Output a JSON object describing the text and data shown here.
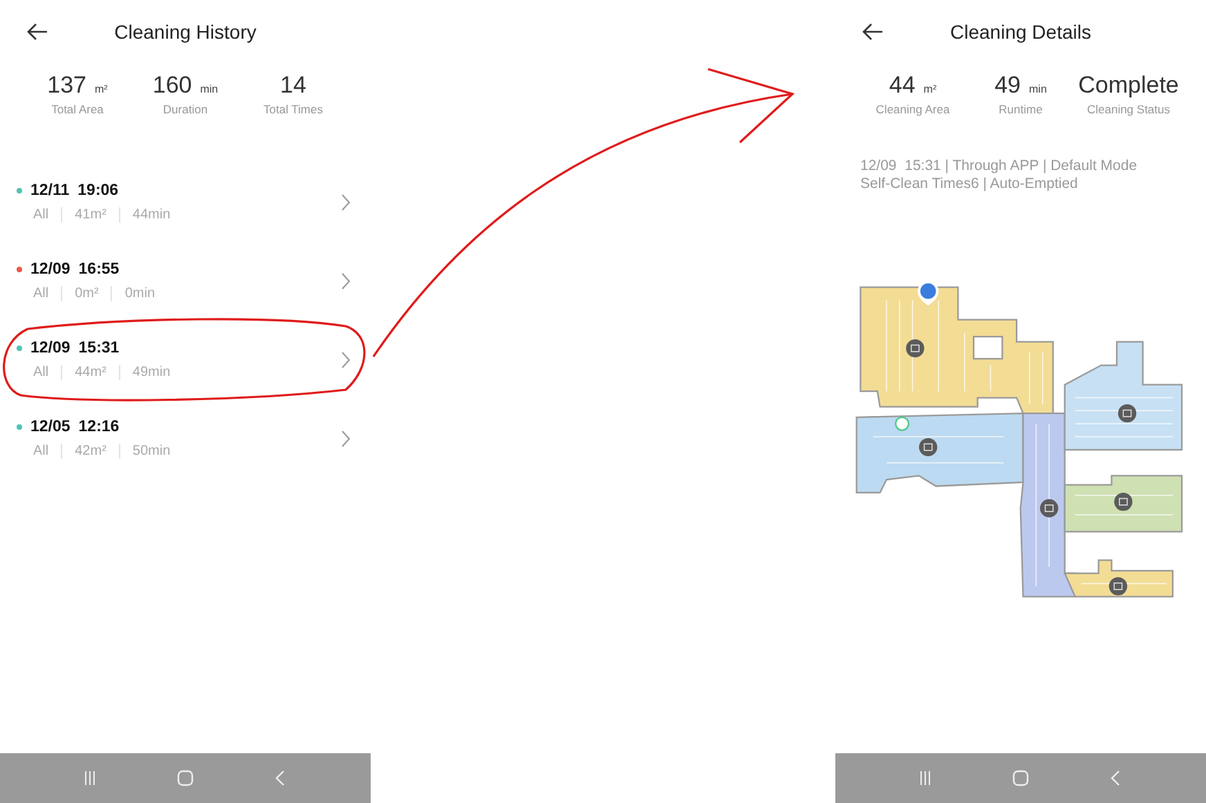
{
  "history_screen": {
    "title": "Cleaning History",
    "stats": [
      {
        "value": "137",
        "unit": "m²",
        "label": "Total Area"
      },
      {
        "value": "160",
        "unit": "min",
        "label": "Duration"
      },
      {
        "value": "14",
        "label": "Total Times"
      }
    ],
    "records": [
      {
        "date": "12/11",
        "time": "19:06",
        "mode": "All",
        "area": "41m²",
        "duration": "44min",
        "color": "#4fc3b4",
        "circled": false
      },
      {
        "date": "12/09",
        "time": "16:55",
        "mode": "All",
        "area": "0m²",
        "duration": "0min",
        "color": "#f0564b",
        "circled": false
      },
      {
        "date": "12/09",
        "time": "15:31",
        "mode": "All",
        "area": "44m²",
        "duration": "49min",
        "color": "#4fc3b4",
        "circled": true
      },
      {
        "date": "12/05",
        "time": "12:16",
        "mode": "All",
        "area": "42m²",
        "duration": "50min",
        "color": "#4fc3b4",
        "circled": false
      }
    ]
  },
  "details_screen": {
    "title": "Cleaning Details",
    "stats": [
      {
        "value": "44",
        "unit": "m²",
        "label": "Cleaning Area"
      },
      {
        "value": "49",
        "unit": "min",
        "label": "Runtime"
      },
      {
        "value": "Complete",
        "label": "Cleaning Status"
      }
    ],
    "info_lines": [
      "12/09  15:31 | Through APP | Default Mode",
      "Self-Clean Times6 | Auto-Emptied"
    ]
  }
}
